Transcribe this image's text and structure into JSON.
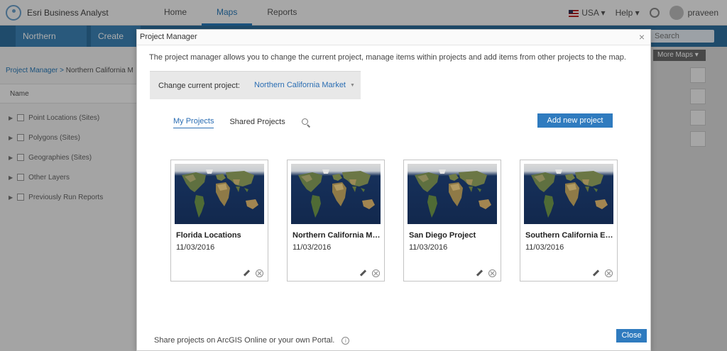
{
  "app": {
    "brand": "Esri Business Analyst",
    "nav": [
      "Home",
      "Maps",
      "Reports"
    ],
    "country": "USA",
    "help": "Help",
    "user": "praveen"
  },
  "subbar": {
    "tab1": "Northern Califo...",
    "tab2": "Create Ma",
    "search_placeholder": "Search"
  },
  "leftpanel": {
    "breadcrumb_root": "Project Manager",
    "breadcrumb_sep": ">",
    "breadcrumb_current": "Northern California M",
    "column_header": "Name",
    "layers": [
      "Point Locations (Sites)",
      "Polygons (Sites)",
      "Geographies (Sites)",
      "Other Layers",
      "Previously Run Reports"
    ]
  },
  "map": {
    "basemap_select": "More Maps"
  },
  "modal": {
    "title": "Project Manager",
    "close_glyph": "×",
    "description": "The project manager allows you to change the current project, manage items within projects and add items from other projects to the map.",
    "change_label": "Change current project:",
    "current_project": "Northern California Market",
    "tabs": {
      "my_projects": "My Projects",
      "shared_projects": "Shared Projects"
    },
    "add_button": "Add new project",
    "projects": [
      {
        "title": "Florida Locations",
        "date": "11/03/2016"
      },
      {
        "title": "Northern California Mar...",
        "date": "11/03/2016"
      },
      {
        "title": "San Diego Project",
        "date": "11/03/2016"
      },
      {
        "title": "Southern California Exp...",
        "date": "11/03/2016"
      }
    ],
    "footer_text": "Share projects on ArcGIS Online or your own Portal.",
    "close_button": "Close"
  },
  "colors": {
    "accent": "#2f7bbf",
    "link": "#2a6db3",
    "ocean": "#16305a"
  }
}
